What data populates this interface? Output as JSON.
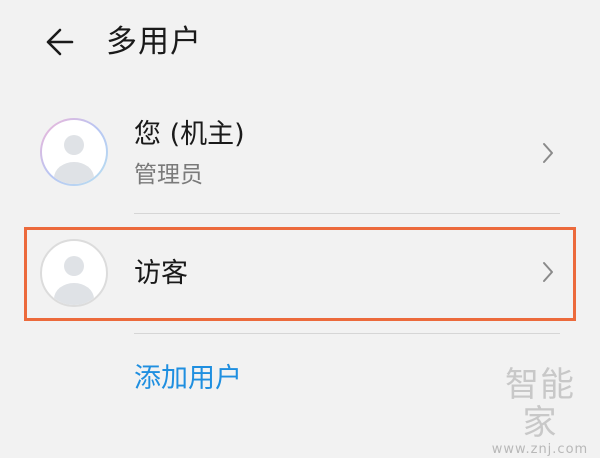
{
  "header": {
    "title": "多用户",
    "back_icon": "arrow-left-icon"
  },
  "users": {
    "owner": {
      "name": "您 (机主)",
      "role": "管理员",
      "avatar_icon": "user-avatar-icon"
    },
    "guest": {
      "name": "访客",
      "avatar_icon": "user-avatar-icon"
    }
  },
  "actions": {
    "add_user_label": "添加用户"
  },
  "watermark": {
    "brand": "智能家",
    "url": "www.znj.com"
  },
  "colors": {
    "background": "#f2f2f2",
    "accent_blue": "#1f8fe0",
    "highlight_orange": "#ec6a3c",
    "subtitle_gray": "#7a7a7a"
  }
}
